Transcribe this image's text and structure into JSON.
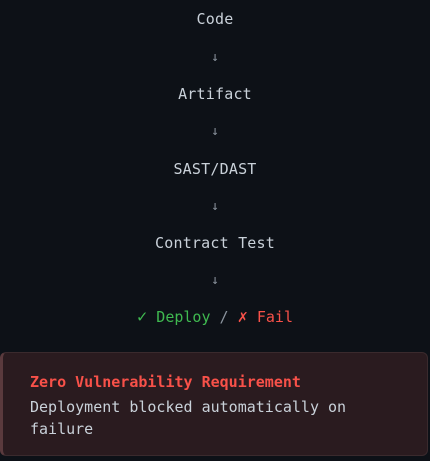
{
  "pipeline": {
    "steps": [
      "Code",
      "Artifact",
      "SAST/DAST",
      "Contract Test"
    ],
    "arrow": "↓",
    "outcome": {
      "success_mark": "✓",
      "success_label": "Deploy",
      "separator": "/",
      "fail_mark": "✗",
      "fail_label": "Fail"
    }
  },
  "alert": {
    "title": "Zero Vulnerability Requirement",
    "body": "Deployment blocked automatically on failure"
  },
  "colors": {
    "background": "#0d1117",
    "text": "#c9d1d9",
    "success": "#3fb950",
    "danger": "#f85149",
    "alert_bg": "#2a1b1f"
  }
}
